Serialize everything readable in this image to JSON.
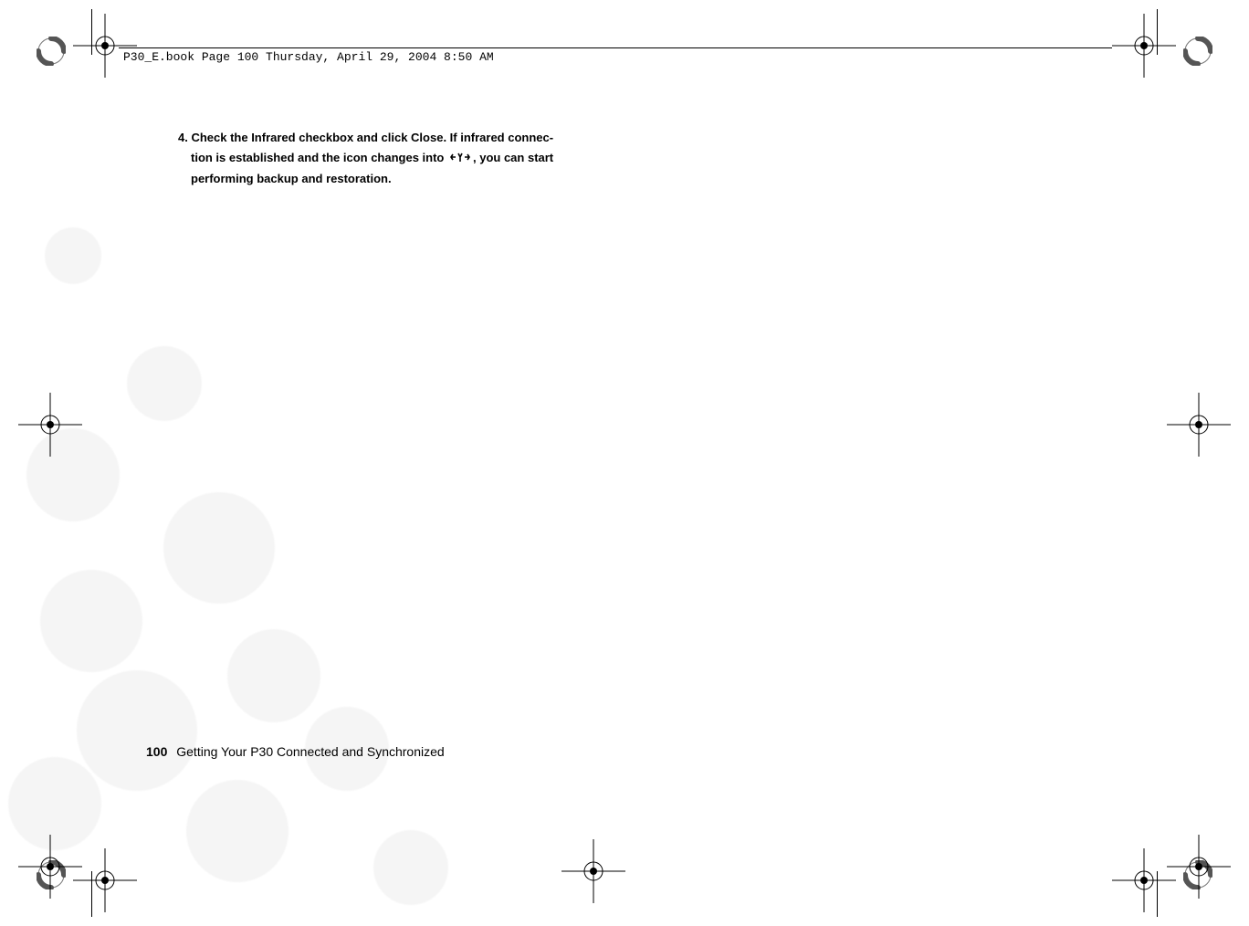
{
  "header": {
    "running_head": "P30_E.book  Page 100  Thursday, April 29, 2004  8:50 AM"
  },
  "body": {
    "step_number": "4.",
    "line1": "4. Check the Infrared checkbox and click Close. If infrared connec-",
    "line2_before_icon": "tion is established and the icon changes into ",
    "line2_after_icon": ", you can start",
    "line3": "performing backup and restoration.",
    "icon_name": "infrared-sync-icon"
  },
  "footer": {
    "page_number": "100",
    "section_title": "Getting Your P30 Connected and Synchronized"
  }
}
